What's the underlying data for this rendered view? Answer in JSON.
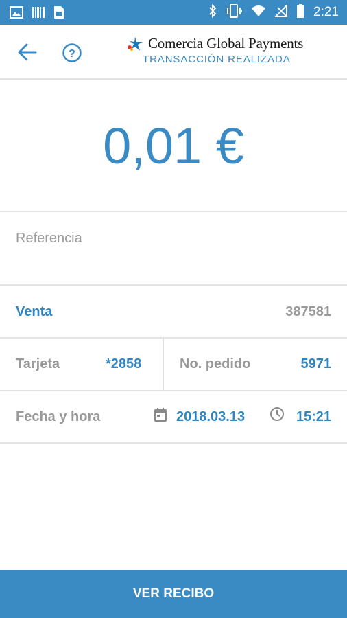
{
  "status_bar": {
    "time": "2:21",
    "icons": [
      "image-icon",
      "barcode-icon",
      "sim-icon",
      "bluetooth-icon",
      "vibrate-icon",
      "wifi-icon",
      "no-signal-icon",
      "battery-icon"
    ]
  },
  "header": {
    "brand_name": "Comercia Global Payments",
    "subtitle": "TRANSACCIÓN REALIZADA",
    "back_icon": "arrow-left-icon",
    "help_icon": "help-circle-icon"
  },
  "transaction": {
    "amount": "0,01 €",
    "reference_label": "Referencia",
    "type_label": "Venta",
    "type_value": "387581",
    "card_label": "Tarjeta",
    "card_value": "*2858",
    "order_label": "No. pedido",
    "order_value": "5971",
    "datetime_label": "Fecha y hora",
    "date_value": "2018.03.13",
    "time_value": "15:21"
  },
  "footer": {
    "button_label": "VER RECIBO"
  },
  "colors": {
    "accent": "#3a8ac3",
    "label_grey": "#9a9a9a",
    "divider": "#e3e3e3"
  }
}
